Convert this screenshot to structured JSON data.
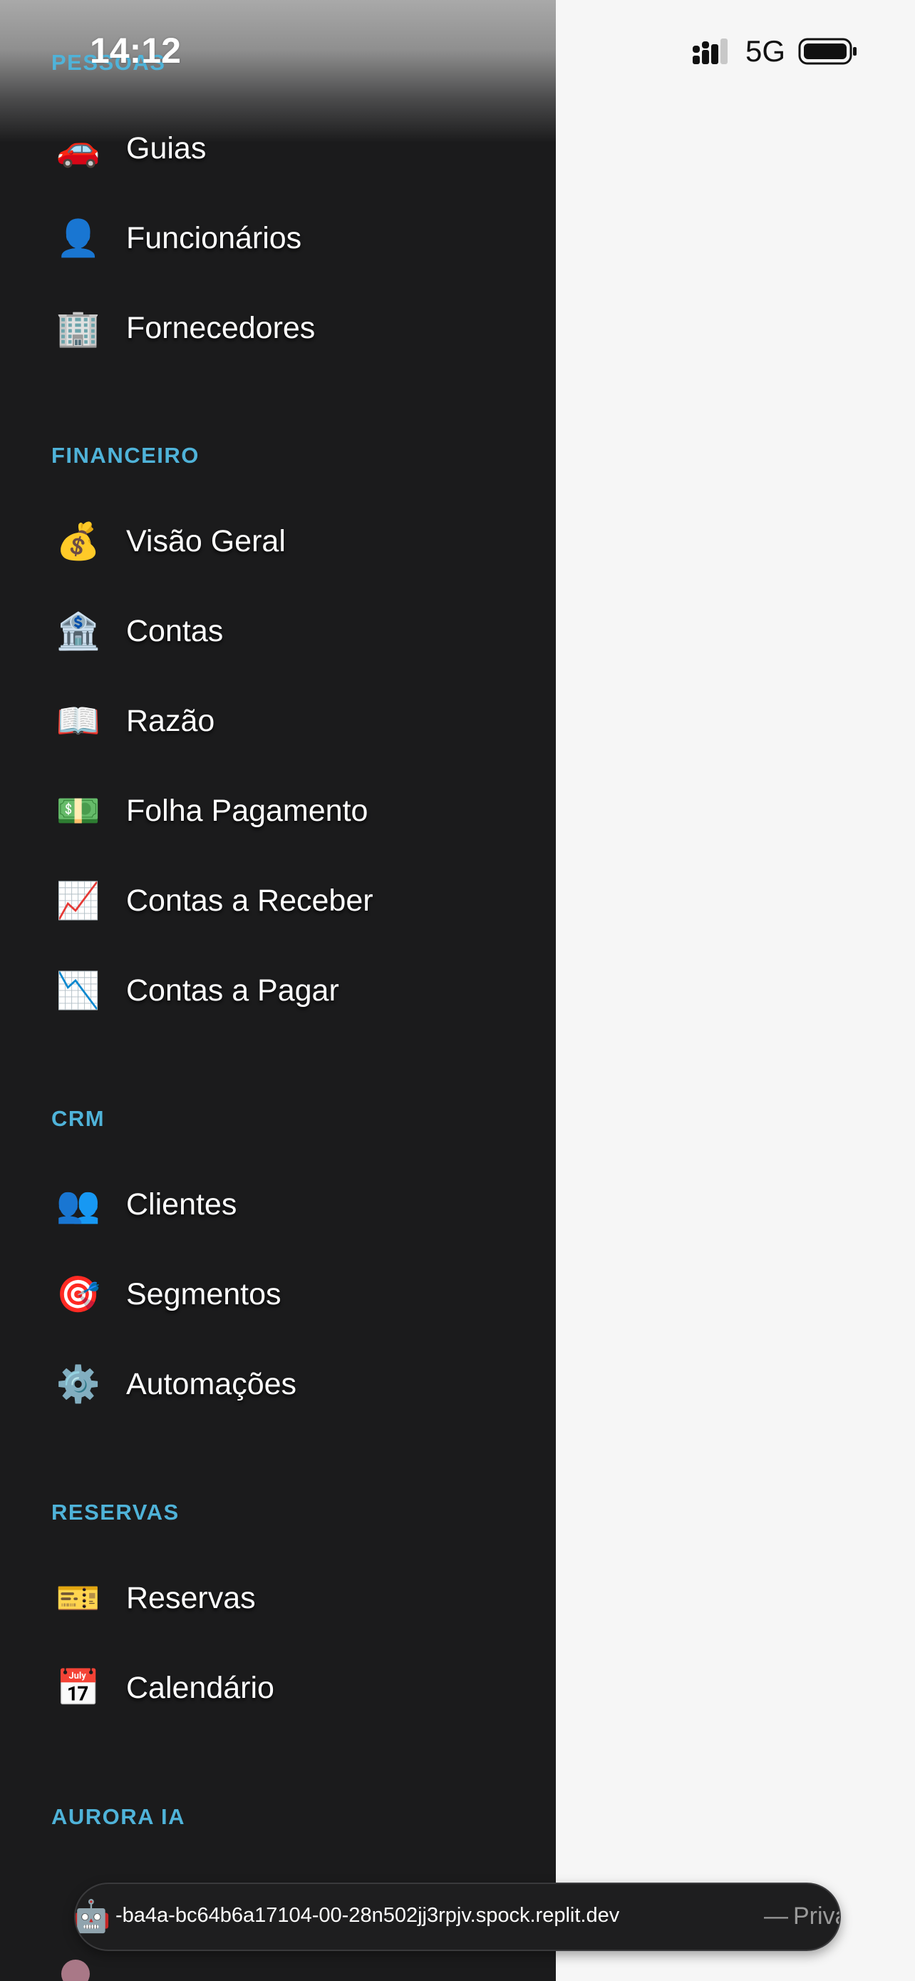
{
  "status_bar": {
    "time": "14:12",
    "network": "5G",
    "signal_icon": "signal-bars-icon",
    "battery_icon": "battery-icon"
  },
  "sections": {
    "pessoas": {
      "title": "PESSOAS",
      "items": [
        {
          "label": "Guias",
          "icon": "🚗",
          "icon_name": "car-icon"
        },
        {
          "label": "Funcionários",
          "icon": "👤",
          "icon_name": "person-icon"
        },
        {
          "label": "Fornecedores",
          "icon": "🏢",
          "icon_name": "building-icon"
        }
      ]
    },
    "financeiro": {
      "title": "FINANCEIRO",
      "items": [
        {
          "label": "Visão Geral",
          "icon": "💰",
          "icon_name": "money-bag-icon"
        },
        {
          "label": "Contas",
          "icon": "🏦",
          "icon_name": "bank-icon"
        },
        {
          "label": "Razão",
          "icon": "📖",
          "icon_name": "open-book-icon"
        },
        {
          "label": "Folha Pagamento",
          "icon": "💵",
          "icon_name": "banknote-icon"
        },
        {
          "label": "Contas a Receber",
          "icon": "📈",
          "icon_name": "chart-up-icon"
        },
        {
          "label": "Contas a Pagar",
          "icon": "📉",
          "icon_name": "chart-down-icon"
        }
      ]
    },
    "crm": {
      "title": "CRM",
      "items": [
        {
          "label": "Clientes",
          "icon": "👥",
          "icon_name": "people-icon"
        },
        {
          "label": "Segmentos",
          "icon": "🎯",
          "icon_name": "target-icon"
        },
        {
          "label": "Automações",
          "icon": "⚙️",
          "icon_name": "gear-icon"
        }
      ]
    },
    "reservas": {
      "title": "RESERVAS",
      "items": [
        {
          "label": "Reservas",
          "icon": "🎫",
          "icon_name": "ticket-icon"
        },
        {
          "label": "Calendário",
          "icon": "📅",
          "icon_name": "calendar-icon"
        }
      ]
    },
    "aurora": {
      "title": "AURORA IA",
      "items": [
        {
          "icon": "🤖",
          "icon_name": "robot-icon"
        }
      ]
    }
  },
  "url_bar": {
    "url": "-ba4a-bc64b6a17104-00-28n502jj3rpjv.spock.replit.dev",
    "separator": "—",
    "private_label": "Privado"
  },
  "colors": {
    "drawer_bg": "#1b1b1c",
    "section_title": "#4fb3d9",
    "page_bg": "#f6f6f6"
  }
}
